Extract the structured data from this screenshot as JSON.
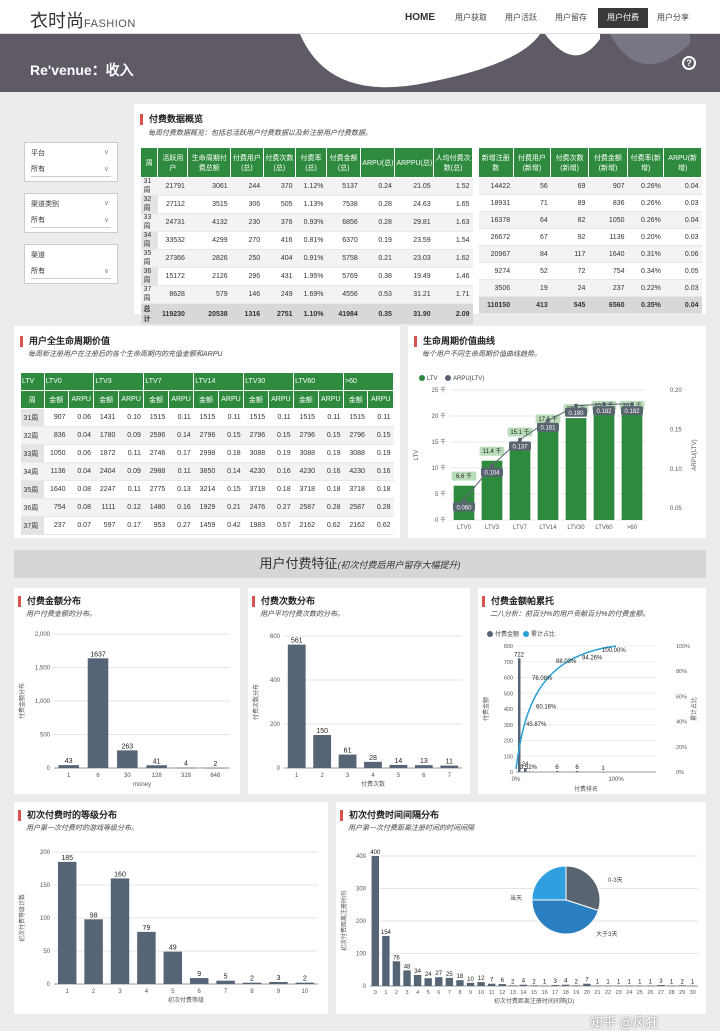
{
  "nav": {
    "logo_main": "衣时尚",
    "logo_sub": "FASHION",
    "home": "HOME",
    "items": [
      "用户获取",
      "用户活跃",
      "用户留存",
      "用户付费",
      "用户分享"
    ],
    "active": "用户付费"
  },
  "banner": {
    "title": "Re'venue：收入"
  },
  "filters": [
    {
      "label": "平台",
      "value": "所有"
    },
    {
      "label": "渠道类别",
      "value": "所有"
    },
    {
      "label": "渠道",
      "value": "所有"
    }
  ],
  "overview": {
    "title": "付费数据概览",
    "subtitle": "每周付费数据概览：包括总活跃用户付费数据以及新注册用户付费数据。",
    "left_headers": [
      "周",
      "活跃用户",
      "生命周期付费总额",
      "付费用户(总)",
      "付费次数(总)",
      "付费率(总)",
      "付费金额(总)",
      "ARPU(总)",
      "ARPPU(总)",
      "人均付费次数(总)"
    ],
    "left_rows": [
      [
        "31周",
        "21791",
        "3061",
        "244",
        "370",
        "1.12%",
        "5137",
        "0.24",
        "21.05",
        "1.52"
      ],
      [
        "32周",
        "27112",
        "3515",
        "306",
        "505",
        "1.13%",
        "7538",
        "0.28",
        "24.63",
        "1.65"
      ],
      [
        "33周",
        "24731",
        "4132",
        "230",
        "376",
        "0.93%",
        "6856",
        "0.28",
        "29.81",
        "1.63"
      ],
      [
        "34周",
        "33532",
        "4299",
        "270",
        "416",
        "0.81%",
        "6370",
        "0.19",
        "23.59",
        "1.54"
      ],
      [
        "35周",
        "27366",
        "2826",
        "250",
        "404",
        "0.91%",
        "5758",
        "0.21",
        "23.03",
        "1.62"
      ],
      [
        "36周",
        "15172",
        "2126",
        "296",
        "431",
        "1.95%",
        "5769",
        "0.38",
        "19.49",
        "1.46"
      ],
      [
        "37周",
        "8628",
        "579",
        "146",
        "249",
        "1.69%",
        "4556",
        "0.53",
        "31.21",
        "1.71"
      ]
    ],
    "left_total": [
      "总计",
      "119230",
      "20538",
      "1316",
      "2751",
      "1.10%",
      "41984",
      "0.35",
      "31.90",
      "2.09"
    ],
    "right_headers": [
      "新增注册数",
      "付费用户(新增)",
      "付费次数(新增)",
      "付费金额(新增)",
      "付费率(新增)",
      "ARPU(新增)"
    ],
    "right_rows": [
      [
        "14422",
        "56",
        "69",
        "907",
        "0.26%",
        "0.04"
      ],
      [
        "18931",
        "71",
        "89",
        "836",
        "0.26%",
        "0.03"
      ],
      [
        "16378",
        "64",
        "82",
        "1050",
        "0.26%",
        "0.04"
      ],
      [
        "26672",
        "67",
        "92",
        "1136",
        "0.20%",
        "0.03"
      ],
      [
        "20967",
        "84",
        "117",
        "1640",
        "0.31%",
        "0.06"
      ],
      [
        "9274",
        "52",
        "72",
        "754",
        "0.34%",
        "0.05"
      ],
      [
        "3506",
        "19",
        "24",
        "237",
        "0.22%",
        "0.03"
      ]
    ],
    "right_total": [
      "110150",
      "413",
      "545",
      "6560",
      "0.35%",
      "0.04"
    ]
  },
  "ltv": {
    "title": "用户全生命周期价值",
    "subtitle": "每周新注册用户在注册后的各个生命周期内的充值金额和ARPU",
    "groups": [
      "LTV",
      "LTV0",
      "LTV3",
      "LTV7",
      "LTV14",
      "LTV30",
      "LTV60",
      ">60"
    ],
    "sub_headers": [
      "周",
      "金额",
      "ARPU",
      "金额",
      "ARPU",
      "金额",
      "ARPU",
      "金额",
      "ARPU",
      "金额",
      "ARPU",
      "金额",
      "ARPU",
      "金额",
      "ARPU"
    ],
    "rows": [
      [
        "31周",
        "907",
        "0.06",
        "1431",
        "0.10",
        "1515",
        "0.11",
        "1515",
        "0.11",
        "1515",
        "0.11",
        "1515",
        "0.11",
        "1515",
        "0.11"
      ],
      [
        "32周",
        "836",
        "0.04",
        "1780",
        "0.09",
        "2596",
        "0.14",
        "2796",
        "0.15",
        "2796",
        "0.15",
        "2796",
        "0.15",
        "2796",
        "0.15"
      ],
      [
        "33周",
        "1050",
        "0.06",
        "1872",
        "0.11",
        "2746",
        "0.17",
        "2998",
        "0.18",
        "3088",
        "0.19",
        "3088",
        "0.19",
        "3088",
        "0.19"
      ],
      [
        "34周",
        "1136",
        "0.04",
        "2404",
        "0.09",
        "2988",
        "0.11",
        "3850",
        "0.14",
        "4230",
        "0.16",
        "4230",
        "0.16",
        "4230",
        "0.16"
      ],
      [
        "35周",
        "1640",
        "0.08",
        "2247",
        "0.11",
        "2775",
        "0.13",
        "3214",
        "0.15",
        "3718",
        "0.18",
        "3718",
        "0.18",
        "3718",
        "0.18"
      ],
      [
        "36周",
        "754",
        "0.08",
        "1111",
        "0.12",
        "1480",
        "0.16",
        "1929",
        "0.21",
        "2476",
        "0.27",
        "2587",
        "0.28",
        "2587",
        "0.28"
      ],
      [
        "37周",
        "237",
        "0.07",
        "597",
        "0.17",
        "953",
        "0.27",
        "1459",
        "0.42",
        "1983",
        "0.57",
        "2162",
        "0.62",
        "2162",
        "0.62"
      ]
    ]
  },
  "ltv_curve": {
    "title": "生命周期价值曲线",
    "subtitle": "每个用户不同生命周期价值曲线趋势。",
    "chart_data": {
      "type": "bar",
      "categories": [
        "LTV0",
        "LTV3",
        "LTV7",
        "LTV14",
        "LTV30",
        "LTV60",
        ">60"
      ],
      "series": [
        {
          "name": "LTV",
          "values": [
            6.6,
            11.4,
            15.1,
            17.6,
            19.6,
            20.2,
            20.2
          ],
          "labels": [
            "6.6 千",
            "11.4 千",
            "15.1 千",
            "17.6 千",
            "19.6 千",
            "20.2 千",
            "20.2 千"
          ]
        },
        {
          "name": "ARPU(LTV)",
          "values": [
            0.06,
            0.104,
            0.137,
            0.161,
            0.18,
            0.182,
            0.182
          ]
        }
      ],
      "ylabel": "LTV",
      "y2label": "ARPU(LTV)",
      "yticks": [
        "0 千",
        "5 千",
        "10 千",
        "15 千",
        "20 千",
        "25 千"
      ],
      "y2ticks": [
        "0.05",
        "0.10",
        "0.15",
        "0.20"
      ],
      "ylim": [
        0,
        25
      ],
      "y2lim": [
        0.035,
        0.2
      ],
      "colors": {
        "bar": "#2e8b3e",
        "line": "#5a6470"
      }
    }
  },
  "divider": {
    "title": "用户付费特征",
    "note": "(初次付费后用户留存大幅提升)"
  },
  "amount_dist": {
    "title": "付费金额分布",
    "subtitle": "用户付费金额的分布。",
    "chart_data": {
      "type": "bar",
      "categories": [
        "1",
        "6",
        "30",
        "128",
        "328",
        "648"
      ],
      "values": [
        43,
        1637,
        263,
        41,
        4,
        2
      ],
      "ylabel": "付费金额分布",
      "xlabel": "money",
      "ylim": [
        0,
        2000
      ],
      "yticks": [
        "0",
        "500",
        "1,000",
        "1,500",
        "2,000"
      ]
    }
  },
  "count_dist": {
    "title": "付费次数分布",
    "subtitle": "用户平均付费次数的分布。",
    "chart_data": {
      "type": "bar",
      "categories": [
        "1",
        "2",
        "3",
        "4",
        "5",
        "6",
        "7"
      ],
      "values": [
        561,
        150,
        61,
        28,
        14,
        13,
        11
      ],
      "ylabel": "付费次数分布",
      "xlabel": "付费次数",
      "ylim": [
        0,
        600
      ],
      "yticks": [
        "0",
        "200",
        "400",
        "600"
      ]
    }
  },
  "pareto": {
    "title": "付费金额帕累托",
    "subtitle": "二八分析：前百分%的用户贡献百分%的付费金额。",
    "chart_data": {
      "type": "bar",
      "series": [
        {
          "name": "付费金额",
          "values": [
            722,
            24,
            6,
            6,
            1
          ]
        },
        {
          "name": "累计占比",
          "labels": [
            "3.52%",
            "45.87%",
            "60.16%",
            "76.08%",
            "88.03%",
            "94.26%",
            "100.00%"
          ]
        }
      ],
      "ylabel": "付费金额",
      "y2label": "累计占比",
      "xlabel": "付费排名",
      "xticks": [
        "0%",
        "100%"
      ],
      "yticks": [
        "0",
        "100",
        "200",
        "300",
        "400",
        "500",
        "600",
        "700",
        "800"
      ],
      "y2ticks": [
        "0%",
        "20%",
        "40%",
        "60%",
        "80%",
        "100%"
      ],
      "ylim": [
        0,
        800
      ],
      "y2lim": [
        0,
        100
      ]
    }
  },
  "level_dist": {
    "title": "初次付费时的等级分布",
    "subtitle": "用户第一次付费时的游戏等级分布。",
    "chart_data": {
      "type": "bar",
      "categories": [
        "1",
        "2",
        "3",
        "4",
        "5",
        "6",
        "7",
        "8",
        "9",
        "10"
      ],
      "values": [
        185,
        98,
        160,
        79,
        49,
        9,
        5,
        2,
        3,
        2
      ],
      "ylabel": "初次付费等级计数",
      "xlabel": "初次付费等级",
      "ylim": [
        0,
        200
      ],
      "yticks": [
        "0",
        "50",
        "100",
        "150",
        "200"
      ]
    }
  },
  "interval_dist": {
    "title": "初次付费时间间隔分布",
    "subtitle": "用户第一次付费距离注册时间的时间间隔",
    "chart_data": {
      "type": "bar",
      "categories": [
        "0",
        "1",
        "2",
        "3",
        "4",
        "5",
        "6",
        "7",
        "8",
        "9",
        "10",
        "11",
        "12",
        "13",
        "14",
        "15",
        "16",
        "17",
        "18",
        "19",
        "20",
        "21",
        "22",
        "23",
        "24",
        "25",
        "26",
        "27",
        "28",
        "29",
        "30"
      ],
      "values": [
        400,
        154,
        76,
        48,
        34,
        24,
        27,
        25,
        18,
        10,
        12,
        7,
        6,
        2,
        4,
        2,
        1,
        3,
        4,
        2,
        7,
        1,
        1,
        1,
        1,
        1,
        1,
        3,
        1,
        2,
        1
      ],
      "ylabel": "初次付费距离注册时间",
      "xlabel": "初次付费距离注册时间间隔(D)",
      "ylim": [
        0,
        400
      ],
      "yticks": [
        "0",
        "100",
        "200",
        "300",
        "400"
      ],
      "xticks": [
        "0",
        "1",
        "2",
        "3",
        "4",
        "5",
        "6",
        "7",
        "8",
        "9",
        "10",
        "11",
        "12",
        "13",
        "14",
        "15",
        "16",
        "17",
        "18",
        "19",
        "20",
        "21",
        "22",
        "23",
        "24",
        "25",
        "26",
        "27",
        "28",
        "29",
        "30"
      ]
    },
    "pie": {
      "labels": [
        "0-3天",
        "当天",
        "大于3天"
      ],
      "values": [
        30,
        45,
        25
      ],
      "colors": [
        "#5a6470",
        "#2a7fc1",
        "#2f9fe0"
      ]
    }
  },
  "watermark": "知乎 @风狂",
  "colors": {
    "accent": "#d9534f",
    "green": "#2e8b3e",
    "slate": "#566575",
    "banner": "#5f5a66"
  }
}
